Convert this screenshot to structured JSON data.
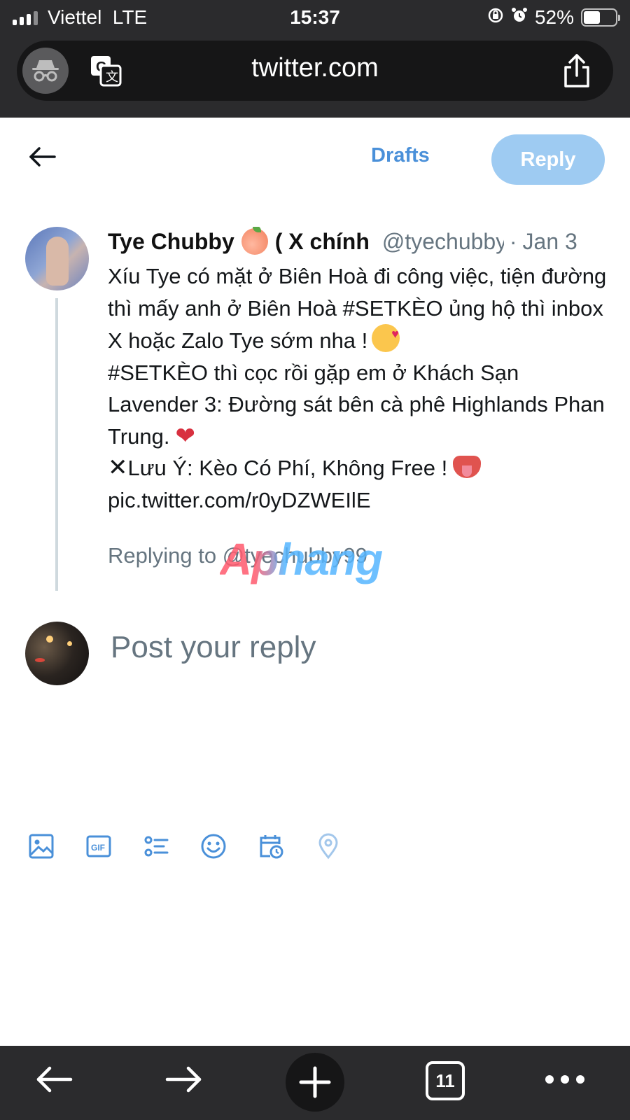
{
  "status_bar": {
    "carrier": "Viettel",
    "network": "LTE",
    "time": "15:37",
    "battery_percent": "52%",
    "battery_level": 0.52,
    "icons": [
      "rotation-lock-icon",
      "alarm-icon"
    ]
  },
  "browser": {
    "url": "twitter.com",
    "tab_count": "11"
  },
  "compose": {
    "drafts_label": "Drafts",
    "reply_label": "Reply",
    "reply_placeholder": "Post your reply"
  },
  "tweet": {
    "author_name": "Tye Chubby",
    "author_name_suffix": "( X chính",
    "handle": "@tyechubby99",
    "date_sep": "·",
    "date": "Jan 3",
    "body_line1": "Xíu Tye có mặt ở Biên Hoà đi công việc, tiện đường thì mấy anh ở Biên Hoà #SETKÈO ủng hộ thì inbox X hoặc Zalo Tye sớm nha !",
    "body_line2": "#SETKÈO thì cọc rồi gặp em ở Khách Sạn Lavender 3: Đường sát bên cà phê Highlands Phan Trung.",
    "warning_mark": "✕",
    "body_line3": "Lưu Ý: Kèo Có Phí, Không Free !",
    "pic_link": "pic.twitter.com/r0yDZWEIlE",
    "replying_to": "Replying to @tyechubby99",
    "watermark": "Aphang"
  },
  "toolbar": {
    "icons": [
      "image-icon",
      "gif-icon",
      "poll-icon",
      "emoji-icon",
      "schedule-icon",
      "location-icon"
    ]
  },
  "colors": {
    "accent": "#4a90d9",
    "reply_button_disabled": "#9ecbf2",
    "chrome_bg": "#2b2b2d",
    "muted_text": "#667580"
  }
}
